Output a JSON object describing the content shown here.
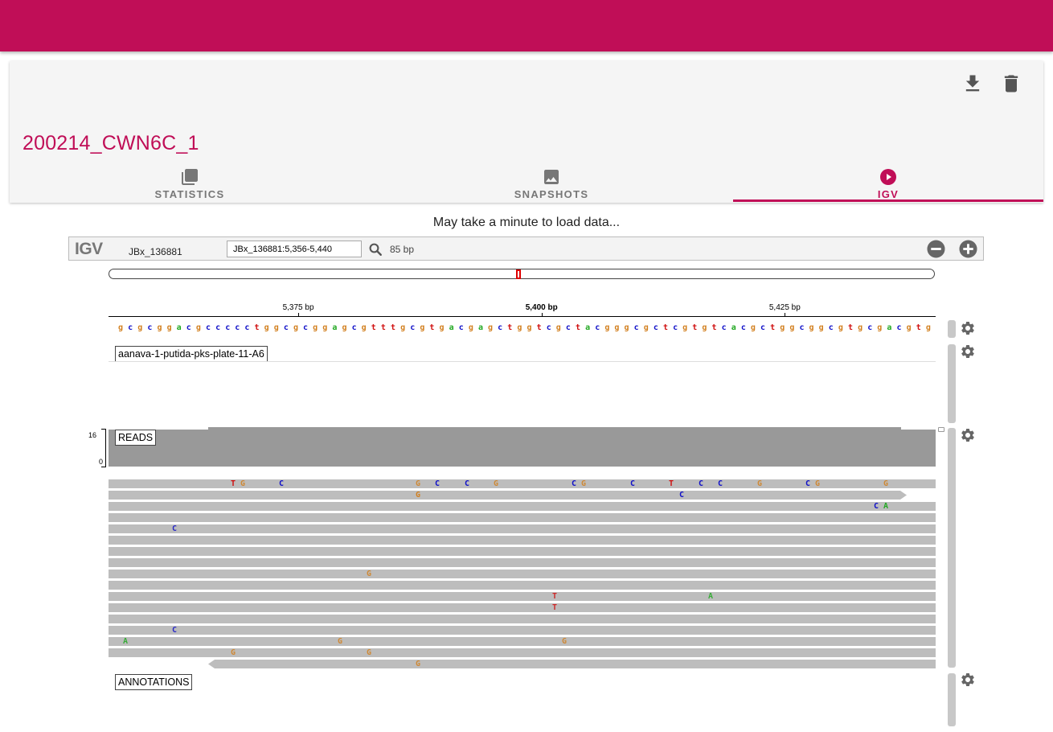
{
  "colors": {
    "brand": "#c00e57"
  },
  "card": {
    "title": "200214_CWN6C_1",
    "actions": [
      {
        "icon": "download-icon"
      },
      {
        "icon": "delete-icon"
      }
    ],
    "tabs": [
      {
        "label": "STATISTICS",
        "icon": "copy-stack-icon",
        "active": false
      },
      {
        "label": "SNAPSHOTS",
        "icon": "image-icon",
        "active": false
      },
      {
        "label": "IGV",
        "icon": "play-circle-icon",
        "active": true
      }
    ]
  },
  "loading_message": "May take a minute to load data...",
  "igv": {
    "logo": "IGV",
    "chromosome": "JBx_136881",
    "locus": "JBx_136881:5,356-5,440",
    "width_bp": "85 bp",
    "ruler_ticks": [
      {
        "label": "5,375 bp",
        "bp": 5375,
        "bold": false
      },
      {
        "label": "5,400 bp",
        "bp": 5400,
        "bold": true
      },
      {
        "label": "5,425 bp",
        "bp": 5425,
        "bold": false
      }
    ],
    "view_start": 5355.5,
    "view_end": 5440.5,
    "sequence": "gcgcggacgccccctggcgcggagcgtttgcgtgacgagctggtcgctacgggcgctcgtgtcacgctggcggcgtgcgacgtggc",
    "track_name": "aanava-1-putida-pks-plate-11-A6",
    "reads_label": "READS",
    "coverage_scale": {
      "max": "16",
      "min": "0"
    },
    "annotations_label": "ANNOTATIONS",
    "reads": [
      {
        "start": 0,
        "end": 1029,
        "arrow": "none",
        "mm": [
          {
            "b": "T",
            "p": 155
          },
          {
            "b": "G",
            "p": 167
          },
          {
            "b": "C",
            "p": 215
          },
          {
            "b": "G",
            "p": 385
          },
          {
            "b": "C",
            "p": 409
          },
          {
            "b": "C",
            "p": 446
          },
          {
            "b": "G",
            "p": 482
          },
          {
            "b": "C",
            "p": 579
          },
          {
            "b": "G",
            "p": 591
          },
          {
            "b": "C",
            "p": 652
          },
          {
            "b": "T",
            "p": 700
          },
          {
            "b": "C",
            "p": 737
          },
          {
            "b": "C",
            "p": 761
          },
          {
            "b": "G",
            "p": 810
          },
          {
            "b": "C",
            "p": 870
          },
          {
            "b": "G",
            "p": 882
          },
          {
            "b": "G",
            "p": 967
          }
        ]
      },
      {
        "start": 0,
        "end": 993,
        "arrow": "right",
        "mm": [
          {
            "b": "G",
            "p": 385
          },
          {
            "b": "C",
            "p": 713
          }
        ]
      },
      {
        "start": 0,
        "end": 1029,
        "arrow": "none",
        "mm": [
          {
            "b": "C",
            "p": 955
          },
          {
            "b": "A",
            "p": 967
          }
        ]
      },
      {
        "start": 0,
        "end": 1029,
        "arrow": "none",
        "mm": []
      },
      {
        "start": 0,
        "end": 1029,
        "arrow": "none",
        "mm": [
          {
            "b": "C",
            "p": 82
          }
        ]
      },
      {
        "start": 0,
        "end": 1029,
        "arrow": "none",
        "mm": []
      },
      {
        "start": 0,
        "end": 1029,
        "arrow": "none",
        "mm": []
      },
      {
        "start": 0,
        "end": 1029,
        "arrow": "none",
        "mm": []
      },
      {
        "start": 0,
        "end": 1029,
        "arrow": "none",
        "mm": [
          {
            "b": "G",
            "p": 324
          }
        ]
      },
      {
        "start": 0,
        "end": 1029,
        "arrow": "none",
        "mm": []
      },
      {
        "start": 0,
        "end": 1029,
        "arrow": "none",
        "mm": [
          {
            "b": "T",
            "p": 555
          },
          {
            "b": "A",
            "p": 749
          }
        ]
      },
      {
        "start": 0,
        "end": 1029,
        "arrow": "none",
        "mm": [
          {
            "b": "T",
            "p": 555
          }
        ]
      },
      {
        "start": 0,
        "end": 1029,
        "arrow": "none",
        "mm": []
      },
      {
        "start": 0,
        "end": 1029,
        "arrow": "none",
        "mm": [
          {
            "b": "C",
            "p": 82
          }
        ]
      },
      {
        "start": 0,
        "end": 1029,
        "arrow": "none",
        "mm": [
          {
            "b": "A",
            "p": 21
          },
          {
            "b": "G",
            "p": 288
          },
          {
            "b": "G",
            "p": 567
          }
        ]
      },
      {
        "start": 0,
        "end": 1029,
        "arrow": "none",
        "mm": [
          {
            "b": "G",
            "p": 155
          },
          {
            "b": "G",
            "p": 324
          }
        ]
      },
      {
        "start": 124,
        "end": 1029,
        "arrow": "left",
        "mm": [
          {
            "b": "G",
            "p": 385
          }
        ]
      }
    ]
  }
}
